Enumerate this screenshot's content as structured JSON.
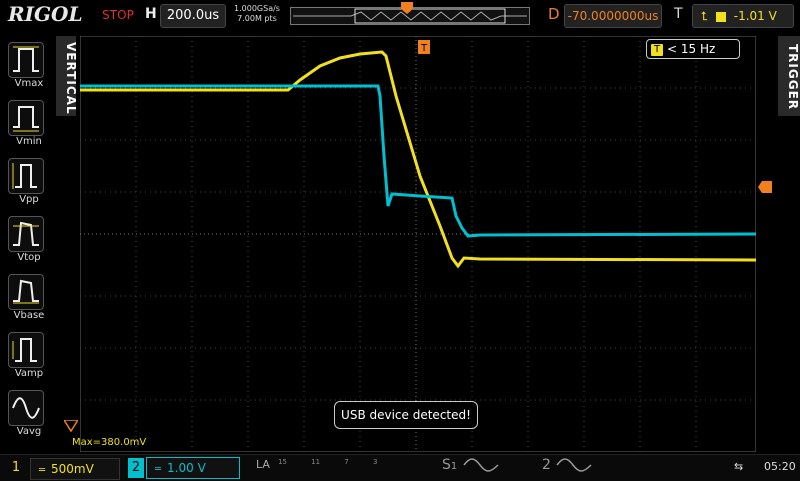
{
  "topbar": {
    "brand": "RIGOL",
    "run_state": "STOP",
    "h_label": "H",
    "timebase": "200.0us",
    "sample_rate": "1.000GSa/s",
    "mem_depth": "7.00M pts",
    "delay_label": "D",
    "delay_value": "-70.0000000us",
    "trig_label": "T",
    "trig_level": "-1.01 V"
  },
  "left_menu": {
    "tab_label": "VERTICAL",
    "items": [
      {
        "label": "Vmax",
        "icon": "vmax-icon"
      },
      {
        "label": "Vmin",
        "icon": "vmin-icon"
      },
      {
        "label": "Vpp",
        "icon": "vpp-icon"
      },
      {
        "label": "Vtop",
        "icon": "vtop-icon"
      },
      {
        "label": "Vbase",
        "icon": "vbase-icon"
      },
      {
        "label": "Vamp",
        "icon": "vamp-icon"
      },
      {
        "label": "Vavg",
        "icon": "vavg-icon"
      }
    ]
  },
  "right_tab": {
    "label": "TRIGGER"
  },
  "screen": {
    "freq_counter": "< 15 Hz",
    "freq_counter_badge": "T",
    "measurement": "Max=380.0mV",
    "notice": "USB device detected!",
    "trigger_marker": "T"
  },
  "bottom": {
    "ch1_num": "1",
    "ch1_scale": "500mV",
    "ch2_num": "2",
    "ch2_scale": "1.00 V",
    "la_label": "LA",
    "la_bits_top": "15 11 7 3",
    "s1_label": "S",
    "s1_num": "1",
    "s2_num": "2",
    "clock": "05:20"
  },
  "colors": {
    "ch1": "#f0e020",
    "ch2": "#00c0d0",
    "trigger": "#f08020",
    "stop": "#e03030"
  }
}
